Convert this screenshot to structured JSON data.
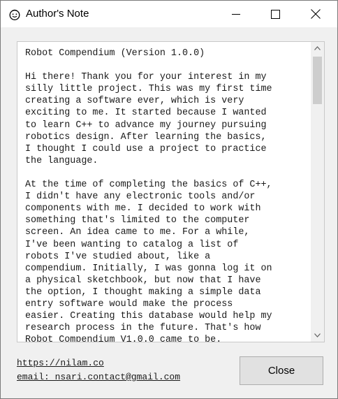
{
  "window": {
    "title": "Author's Note"
  },
  "titlebar_buttons": {
    "minimize_icon": "minimize-icon",
    "maximize_icon": "maximize-icon",
    "close_icon": "close-icon"
  },
  "note": {
    "text": "Robot Compendium (Version 1.0.0)\n\nHi there! Thank you for your interest in my\nsilly little project. This was my first time\ncreating a software ever, which is very\nexciting to me. It started because I wanted\nto learn C++ to advance my journey pursuing\nrobotics design. After learning the basics,\nI thought I could use a project to practice\nthe language.\n\nAt the time of completing the basics of C++,\nI didn't have any electronic tools and/or\ncomponents with me. I decided to work with\nsomething that's limited to the computer\nscreen. An idea came to me. For a while,\nI've been wanting to catalog a list of\nrobots I've studied about, like a\ncompendium. Initially, I was gonna log it on\na physical sketchbook, but now that I have\nthe option, I thought making a simple data\nentry software would make the process\neasier. Creating this database would help my\nresearch process in the future. That's how\nRobot Compendium V1.0.0 came to be."
  },
  "links": {
    "website": "https://nilam.co",
    "email": "email: nsari.contact@gmail.com"
  },
  "buttons": {
    "close_label": "Close"
  },
  "colors": {
    "window_bg": "#f0f0f0",
    "titlebar_bg": "#ffffff",
    "button_bg": "#e1e1e1",
    "scroll_thumb": "#cdcdcd"
  }
}
